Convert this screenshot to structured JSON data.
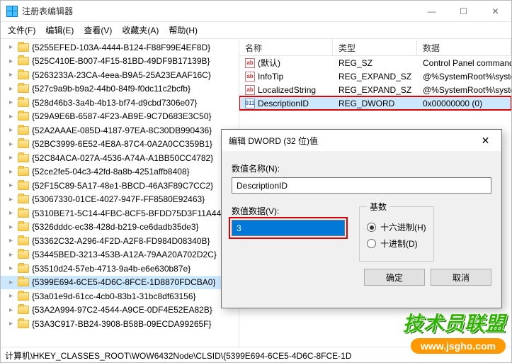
{
  "window": {
    "title": "注册表编辑器",
    "min": "—",
    "max": "☐",
    "close": "✕"
  },
  "menu": {
    "file": "文件(F)",
    "edit": "编辑(E)",
    "view": "查看(V)",
    "fav": "收藏夹(A)",
    "help": "帮助(H)"
  },
  "tree": [
    "{5255EFED-103A-4444-B124-F88F99E4EF8D}",
    "{525C410E-B007-4F15-81BD-49DF9B17139B}",
    "{5263233A-23CA-4eea-B9A5-25A23EAAF16C}",
    "{527c9a9b-b9a2-44b0-84f9-f0dc11c2bcfb}",
    "{528d46b3-3a4b-4b13-bf74-d9cbd7306e07}",
    "{529A9E6B-6587-4F23-AB9E-9C7D683E3C50}",
    "{52A2AAAE-085D-4187-97EA-8C30DB990436}",
    "{52BC3999-6E52-4E8A-87C4-0A2A0CC359B1}",
    "{52C84ACA-027A-4536-A74A-A1BB50CC4782}",
    "{52ce2fe5-04c3-42fd-8a8b-4251affb8408}",
    "{52F15C89-5A17-48e1-BBCD-46A3F89C7CC2}",
    "{53067330-01CE-4027-947F-FF8580E92463}",
    "{5310BE71-5C14-4FBC-8CF5-BFDD75D3F11A44}",
    "{5326dddc-ec38-428d-b219-ce6dadb35de3}",
    "{53362C32-A296-4F2D-A2F8-FD984D08340B}",
    "{53445BED-3213-453B-A12A-79AA20A702D2C}",
    "{53510d24-57eb-4713-9a4b-e6e630b87e}",
    "{5399E694-6CE5-4D6C-8FCE-1D8870FDCBA0}",
    "{53a01e9d-61cc-4cb0-83b1-31bc8df63156}",
    "{53A2A994-97C2-4544-A9CE-0DF4E52EA82B}",
    "{53A3C917-BB24-3908-B58B-09ECDA99265F}"
  ],
  "tree_selected_index": 17,
  "listview": {
    "headers": {
      "name": "名称",
      "type": "类型",
      "data": "数据"
    },
    "rows": [
      {
        "icon": "ab",
        "name": "(默认)",
        "type": "REG_SZ",
        "data": "Control Panel command"
      },
      {
        "icon": "ab",
        "name": "InfoTip",
        "type": "REG_EXPAND_SZ",
        "data": "@%SystemRoot%\\system"
      },
      {
        "icon": "ab",
        "name": "LocalizedString",
        "type": "REG_EXPAND_SZ",
        "data": "@%SystemRoot%\\system"
      },
      {
        "icon": "bin",
        "name": "DescriptionID",
        "type": "REG_DWORD",
        "data": "0x00000000 (0)"
      }
    ],
    "selected_index": 3,
    "highlighted_index": 3
  },
  "dialog": {
    "title": "编辑 DWORD (32 位)值",
    "close": "✕",
    "name_label": "数值名称(N):",
    "name_value": "DescriptionID",
    "value_label": "数值数据(V):",
    "value": "3",
    "radix_label": "基数",
    "hex": "十六进制(H)",
    "dec": "十进制(D)",
    "ok": "确定",
    "cancel": "取消"
  },
  "statusbar": "计算机\\HKEY_CLASSES_ROOT\\WOW6432Node\\CLSID\\{5399E694-6CE5-4D6C-8FCE-1D",
  "watermark": {
    "text": "技术员联盟",
    "url": "www.jsgho.com"
  }
}
